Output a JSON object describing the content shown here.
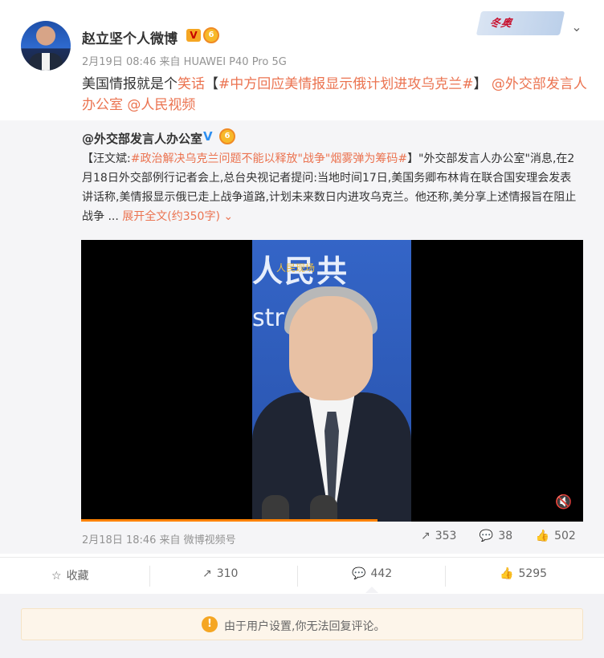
{
  "post": {
    "author": "赵立坚个人微博",
    "meta": "2月19日 08:46 来自 HUAWEI P40 Pro 5G",
    "text_prefix": "美国情报就是个",
    "text_joke": "笑话",
    "text_bracket_open": "【",
    "topic": "#中方回应美情报显示俄计划进攻乌克兰#",
    "text_bracket_close": "】",
    "mention1": "@外交部发言人办公室",
    "mention2": "@人民视频"
  },
  "repost": {
    "author": "@外交部发言人办公室",
    "text_open": "【汪文斌:",
    "topic": "#政治解决乌克兰问题不能以释放\"战争\"烟雾弹为筹码#",
    "text_body": "】\"外交部发言人办公室\"消息,在2月18日外交部例行记者会上,总台央视记者提问:当地时间17日,美国务卿布林肯在联合国安理会发表讲话称,美情报显示俄已走上战争道路,计划未来数日内进攻乌克兰。他还称,美分享上述情报旨在阻止战争 ...",
    "expand": "展开全文(约350字)",
    "video": {
      "watermark": "人民现场",
      "sign_top": "人民共",
      "sign_bottom": "str   Fo",
      "progress": 0.59
    },
    "date": "2月18日 18:46 来自 微博视频号",
    "shares": "353",
    "comments": "38",
    "likes": "502"
  },
  "actions": {
    "favorite": "收藏",
    "share": "310",
    "comment": "442",
    "like": "5295"
  },
  "notice": "由于用户设置,你无法回复评论。",
  "badges": {
    "verified": "V",
    "level": "6"
  },
  "deco_text": "冬奥",
  "icons": {
    "chevron": "chevron-down-icon",
    "mute": "mute-icon",
    "share": "share-icon",
    "comment": "comment-icon",
    "like": "like-icon",
    "favorite": "star-icon",
    "warning": "warning-icon"
  },
  "colors": {
    "link": "#eb7350",
    "progress": "#ff8200",
    "repost_bg": "#f5f5f7"
  }
}
